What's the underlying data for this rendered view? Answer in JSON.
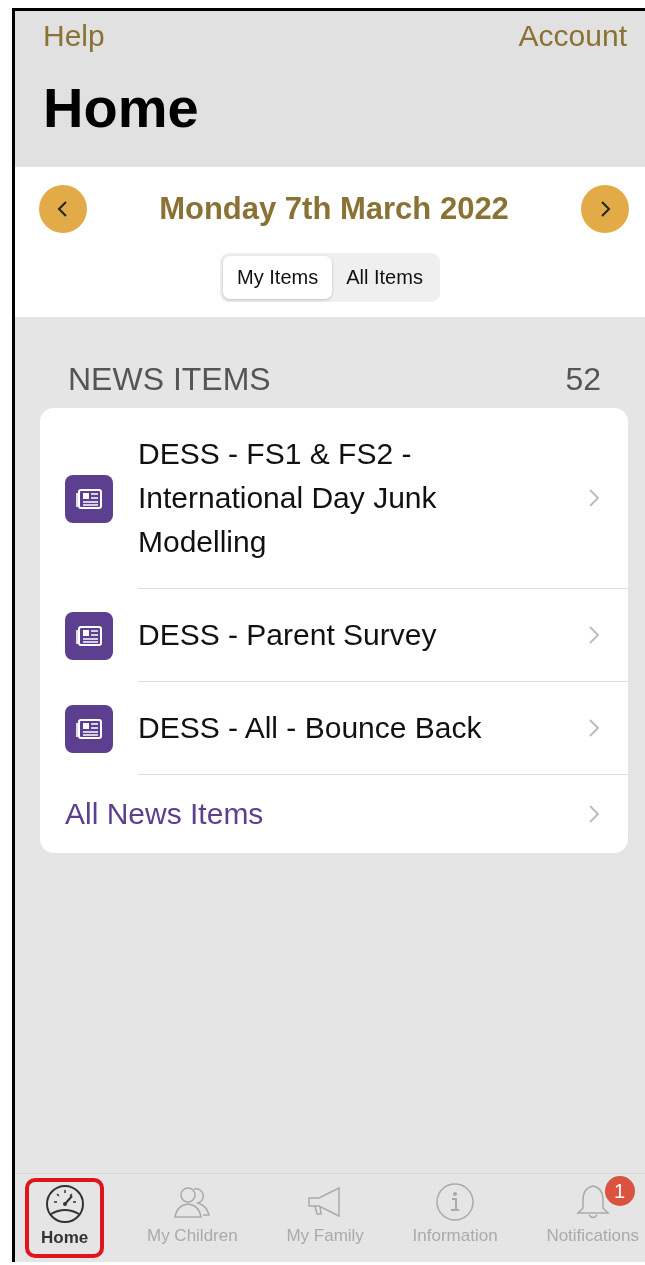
{
  "nav": {
    "left": "Help",
    "right": "Account",
    "title": "Home"
  },
  "date": {
    "label": "Monday 7th March 2022"
  },
  "segments": [
    {
      "label": "My Items",
      "selected": true
    },
    {
      "label": "All Items",
      "selected": false
    }
  ],
  "news": {
    "heading": "NEWS ITEMS",
    "count": "52",
    "items": [
      {
        "title": "DESS - FS1 & FS2 - International Day Junk Modelling"
      },
      {
        "title": "DESS - Parent Survey"
      },
      {
        "title": "DESS - All - Bounce Back"
      }
    ],
    "footer_link": "All News Items"
  },
  "tab_bar": [
    {
      "kind": "gauge",
      "label": "Home",
      "selected": true
    },
    {
      "kind": "people",
      "label": "My Children",
      "selected": false
    },
    {
      "kind": "megaphone",
      "label": "My Family",
      "selected": false
    },
    {
      "kind": "info",
      "label": "Information",
      "selected": false
    },
    {
      "kind": "bell",
      "label": "Notifications",
      "selected": false,
      "badge": "1"
    }
  ]
}
